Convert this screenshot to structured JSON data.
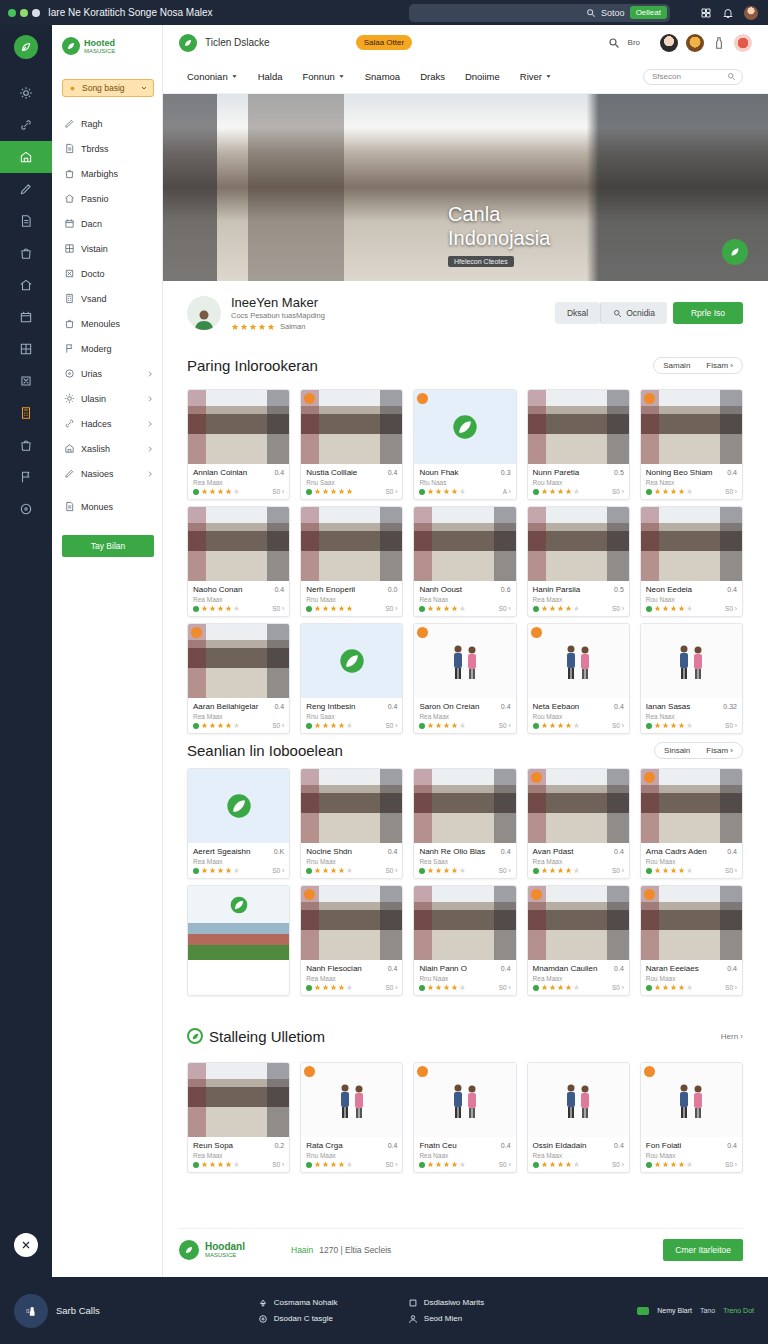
{
  "window": {
    "title": "Iare Ne Koratitich Songe Nosa Malex",
    "search": "Sotoo",
    "search_button": "Oelleat"
  },
  "rail": {
    "items": [
      {
        "selected": false,
        "highlighted": false
      },
      {
        "selected": false,
        "highlighted": false
      },
      {
        "selected": true,
        "highlighted": false
      },
      {
        "selected": false,
        "highlighted": false
      },
      {
        "selected": false,
        "highlighted": false
      },
      {
        "selected": false,
        "highlighted": false
      },
      {
        "selected": false,
        "highlighted": false
      },
      {
        "selected": false,
        "highlighted": false
      },
      {
        "selected": false,
        "highlighted": false
      },
      {
        "selected": false,
        "highlighted": false
      },
      {
        "selected": false,
        "highlighted": true
      },
      {
        "selected": false,
        "highlighted": false
      },
      {
        "selected": false,
        "highlighted": false
      },
      {
        "selected": false,
        "highlighted": false
      }
    ]
  },
  "sidebar": {
    "brand": "Hooted",
    "brand_sub": "MASUSICE",
    "menu_button": "Song basig",
    "items": [
      {
        "label": "Ragh",
        "expandable": false
      },
      {
        "label": "Tbrdss",
        "expandable": false
      },
      {
        "label": "Marbighs",
        "expandable": false
      },
      {
        "label": "Pasnio",
        "expandable": false
      },
      {
        "label": "Dacn",
        "expandable": false
      },
      {
        "label": "Vistain",
        "expandable": false
      },
      {
        "label": "Docto",
        "expandable": false
      },
      {
        "label": "Vsand",
        "expandable": false
      },
      {
        "label": "Menoules",
        "expandable": false
      },
      {
        "label": "Moderg",
        "expandable": false
      },
      {
        "label": "Urias",
        "expandable": true
      },
      {
        "label": "Ulasin",
        "expandable": true
      },
      {
        "label": "Hadces",
        "expandable": true
      },
      {
        "label": "Xaslish",
        "expandable": true
      },
      {
        "label": "Nasioes",
        "expandable": true
      },
      {
        "label": "Monues",
        "expandable": false
      }
    ],
    "action": "Tay Bilan"
  },
  "header": {
    "title": "Ticlen Dslacke",
    "badge": "Salaa Otter",
    "user_code": "Bro"
  },
  "nav": {
    "items": [
      {
        "label": "Cononian",
        "dropdown": true
      },
      {
        "label": "Halda",
        "dropdown": false
      },
      {
        "label": "Fonnun",
        "dropdown": true
      },
      {
        "label": "Snamoa",
        "dropdown": false
      },
      {
        "label": "Draks",
        "dropdown": false
      },
      {
        "label": "Dnoiime",
        "dropdown": false
      },
      {
        "label": "River",
        "dropdown": true
      }
    ],
    "search": "Sfsecon"
  },
  "hero": {
    "title": "Canla Indonojasia",
    "tag": "Hfelecon Cteotes"
  },
  "profile": {
    "name": "IneeYen Maker",
    "subtitle": "Cocs Pesabun tuasMapding",
    "stars": 5,
    "rating_label": "Salman",
    "buttons": [
      {
        "label": "Dksal",
        "kind": "plain"
      },
      {
        "label": "Ocnidia",
        "kind": "search"
      },
      {
        "label": "Rprle Iso",
        "kind": "primary"
      }
    ]
  },
  "sections": [
    {
      "title": "Paring Inlorookeran",
      "icon": false,
      "more": {
        "kind": "pill",
        "labels": [
          "Samain",
          "Fisam ›"
        ]
      },
      "cards": [
        {
          "kind": "mall",
          "title": "Annlan Coinlan",
          "value": "0.4",
          "sub": "Rea Maax",
          "tail": "S0 ›",
          "stars": 4,
          "tagged": false
        },
        {
          "kind": "mall",
          "title": "Nustia Colllaie",
          "value": "0.4",
          "sub": "Rnu Saax",
          "tail": "S0 ›",
          "stars": 5,
          "tagged": true
        },
        {
          "kind": "logo",
          "title": "Noun Fhak",
          "value": "0.3",
          "sub": "Rtu Naas",
          "tail": "A ›",
          "stars": 4,
          "tagged": true
        },
        {
          "kind": "mall",
          "title": "Nunn Paretia",
          "value": "0.5",
          "sub": "Rou Maax",
          "tail": "S0 ›",
          "stars": 4,
          "tagged": false
        },
        {
          "kind": "mall",
          "title": "Noning Beo Shiam",
          "value": "0.4",
          "sub": "Rea Nasx",
          "tail": "S0 ›",
          "stars": 4,
          "tagged": true
        },
        {
          "kind": "mall",
          "title": "Naoho Conan",
          "value": "0.4",
          "sub": "Rea Maax",
          "tail": "S0 ›",
          "stars": 4,
          "tagged": false
        },
        {
          "kind": "mall",
          "title": "Nerh Enoperil",
          "value": "0.0",
          "sub": "Rnu Maax",
          "tail": "S0 ›",
          "stars": 5,
          "tagged": false
        },
        {
          "kind": "mall",
          "title": "Nanh Ooust",
          "value": "0.6",
          "sub": "Rea Naax",
          "tail": "S0 ›",
          "stars": 4,
          "tagged": false
        },
        {
          "kind": "mall",
          "title": "Hanin Parsiia",
          "value": "0.5",
          "sub": "Rea Maax",
          "tail": "S0 ›",
          "stars": 4,
          "tagged": false
        },
        {
          "kind": "mall",
          "title": "Neon Eedeia",
          "value": "0.4",
          "sub": "Rou Naax",
          "tail": "S0 ›",
          "stars": 4,
          "tagged": false
        },
        {
          "kind": "mall",
          "title": "Aaran Beilahigelar",
          "value": "0.4",
          "sub": "Rea Maax",
          "tail": "S0 ›",
          "stars": 4,
          "tagged": true
        },
        {
          "kind": "logo",
          "title": "Reng Intbesin",
          "value": "0.4",
          "sub": "Rnu Saax",
          "tail": "S0 ›",
          "stars": 4,
          "tagged": false
        },
        {
          "kind": "people",
          "title": "Saron On Creian",
          "value": "0.4",
          "sub": "Rea Maax",
          "tail": "S0 ›",
          "stars": 4,
          "tagged": true
        },
        {
          "kind": "people",
          "title": "Neta Eebaon",
          "value": "0.4",
          "sub": "Rou Maax",
          "tail": "S0 ›",
          "stars": 4,
          "tagged": true
        },
        {
          "kind": "people",
          "title": "Ianan Sasas",
          "value": "0.32",
          "sub": "Rea Naax",
          "tail": "S0 ›",
          "stars": 4,
          "tagged": false
        }
      ]
    },
    {
      "title": "Seanlian lin Iobooelean",
      "icon": false,
      "more": {
        "kind": "pill",
        "labels": [
          "Sinsain",
          "Fisam ›"
        ]
      },
      "cards": [
        {
          "kind": "logo",
          "title": "Aerert Sgeaishn",
          "value": "0.K",
          "sub": "Rea Maax",
          "tail": "S0 ›",
          "stars": 4,
          "tagged": false
        },
        {
          "kind": "mall",
          "title": "Noclne Shdn",
          "value": "0.4",
          "sub": "Rnu Maax",
          "tail": "S0 ›",
          "stars": 4,
          "tagged": false
        },
        {
          "kind": "mall",
          "title": "Nanh Re Olio Bias",
          "value": "0.4",
          "sub": "Rea Saax",
          "tail": "S0 ›",
          "stars": 4,
          "tagged": false
        },
        {
          "kind": "mall",
          "title": "Avan Pdast",
          "value": "0.4",
          "sub": "Rea Maax",
          "tail": "S0 ›",
          "stars": 4,
          "tagged": true
        },
        {
          "kind": "mall",
          "title": "Arna Cadrs Aden",
          "value": "0.4",
          "sub": "Rou Maax",
          "tail": "S0 ›",
          "stars": 4,
          "tagged": true
        },
        {
          "kind": "banner"
        },
        {
          "kind": "mall",
          "title": "Nanh Flesocian",
          "value": "0.4",
          "sub": "Rea Maax",
          "tail": "S0 ›",
          "stars": 4,
          "tagged": true
        },
        {
          "kind": "mall",
          "title": "Nlain Pann O",
          "value": "0.4",
          "sub": "Rnu Naax",
          "tail": "S0 ›",
          "stars": 4,
          "tagged": false
        },
        {
          "kind": "mall",
          "title": "Mnamdan Caulien",
          "value": "0.4",
          "sub": "Rea Maax",
          "tail": "S0 ›",
          "stars": 4,
          "tagged": true
        },
        {
          "kind": "mall",
          "title": "Naran Eeeiaes",
          "value": "0.4",
          "sub": "Rou Maax",
          "tail": "S0 ›",
          "stars": 4,
          "tagged": true
        }
      ]
    },
    {
      "title": "Stalleing Ulletiom",
      "icon": true,
      "more": {
        "kind": "link",
        "labels": [
          "Hern ›"
        ]
      },
      "cards": [
        {
          "kind": "mall",
          "title": "Reun Sopa",
          "value": "0.2",
          "sub": "Rea Maax",
          "tail": "S0 ›",
          "stars": 4,
          "tagged": false
        },
        {
          "kind": "people",
          "title": "Rata Crga",
          "value": "0.4",
          "sub": "Rnu Maax",
          "tail": "S0 ›",
          "stars": 4,
          "tagged": true
        },
        {
          "kind": "people",
          "title": "Fnatn Ceu",
          "value": "0.4",
          "sub": "Rea Naax",
          "tail": "S0 ›",
          "stars": 4,
          "tagged": true
        },
        {
          "kind": "people",
          "title": "Ossin Eldadain",
          "value": "0.4",
          "sub": "Rea Maax",
          "tail": "S0 ›",
          "stars": 4,
          "tagged": false
        },
        {
          "kind": "people",
          "title": "Fon Foiati",
          "value": "0.4",
          "sub": "Rou Maax",
          "tail": "S0 ›",
          "stars": 4,
          "tagged": true
        }
      ]
    }
  ],
  "footer": {
    "brand": "Hoodanl",
    "brand_sub": "MASUSICE",
    "label": "Haain",
    "info": "1270 | Eltia Secleis",
    "button": "Cmer Itarleitoe"
  },
  "bottom_bar": {
    "label": "Sarb Calls",
    "links": [
      "Cosmama Nohalk",
      "Dsdlasiwo Marits",
      "Dsodan C tasgle",
      "Seod Mien"
    ],
    "badge": "Nemy Blart",
    "extras": [
      "Tano",
      "Treno Dot"
    ]
  }
}
